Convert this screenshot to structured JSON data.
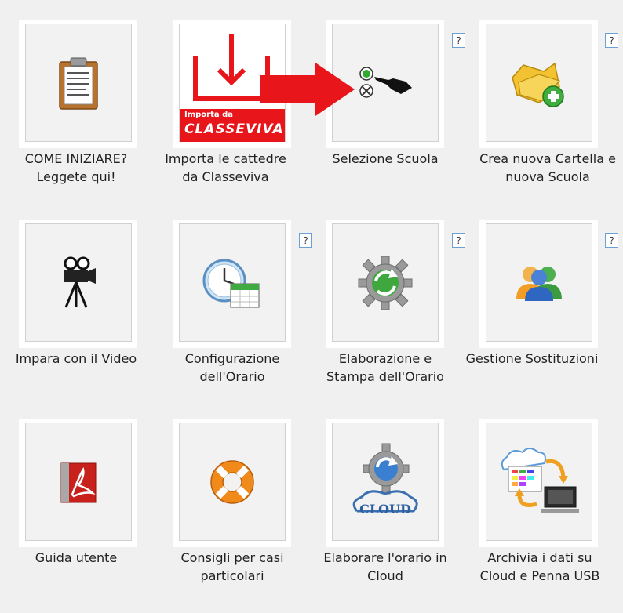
{
  "tiles": [
    {
      "id": "come-iniziare",
      "label": "COME INIZIARE? Leggete qui!",
      "icon": "clipboard-icon",
      "help": false
    },
    {
      "id": "importa-classeviva",
      "label": "Importa le cattedre da Classeviva",
      "icon": "import-classeviva-icon",
      "help": false,
      "badge_top": "Importa da",
      "badge_brand": "CLASSEVIVA"
    },
    {
      "id": "selezione-scuola",
      "label": "Selezione Scuola",
      "icon": "select-school-icon",
      "help": true
    },
    {
      "id": "crea-cartella",
      "label": "Crea nuova Cartella e nuova Scuola",
      "icon": "new-folder-icon",
      "help": true
    },
    {
      "id": "impara-video",
      "label": "Impara con il Video",
      "icon": "video-camera-icon",
      "help": false
    },
    {
      "id": "configurazione-orario",
      "label": "Configurazione dell'Orario",
      "icon": "clock-calendar-icon",
      "help": true
    },
    {
      "id": "elaborazione-stampa",
      "label": "Elaborazione e Stampa dell'Orario",
      "icon": "gear-refresh-icon",
      "help": true
    },
    {
      "id": "gestione-sostituzioni",
      "label": "Gestione Sostituzioni",
      "icon": "users-icon",
      "help": true
    },
    {
      "id": "guida-utente",
      "label": "Guida utente",
      "icon": "pdf-icon",
      "help": false
    },
    {
      "id": "consigli-casi",
      "label": "Consigli per casi particolari",
      "icon": "lifebuoy-icon",
      "help": false
    },
    {
      "id": "orario-cloud",
      "label": "Elaborare l'orario in Cloud",
      "icon": "cloud-gear-icon",
      "help": false,
      "badge_brand": "CLOUD"
    },
    {
      "id": "archivia-dati",
      "label": "Archivia i dati su Cloud e Penna USB",
      "icon": "cloud-backup-icon",
      "help": false
    }
  ],
  "help_label": "?",
  "colors": {
    "accent_red": "#e8161b",
    "help_border": "#6aa0d8",
    "background": "#f0f0f0"
  }
}
